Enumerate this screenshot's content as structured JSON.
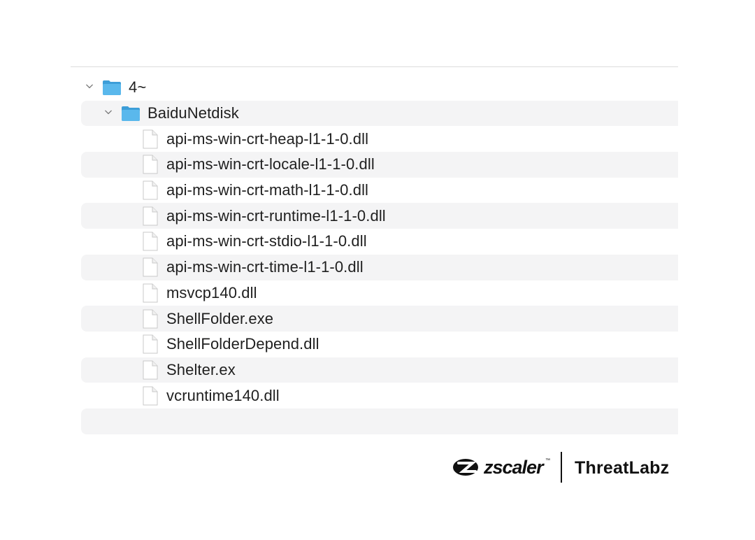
{
  "tree": {
    "rows": [
      {
        "kind": "folder",
        "depth": 0,
        "expanded": true,
        "name": "4~"
      },
      {
        "kind": "folder",
        "depth": 1,
        "expanded": true,
        "name": "BaiduNetdisk"
      },
      {
        "kind": "file",
        "depth": 2,
        "name": "api-ms-win-crt-heap-l1-1-0.dll"
      },
      {
        "kind": "file",
        "depth": 2,
        "name": "api-ms-win-crt-locale-l1-1-0.dll"
      },
      {
        "kind": "file",
        "depth": 2,
        "name": "api-ms-win-crt-math-l1-1-0.dll"
      },
      {
        "kind": "file",
        "depth": 2,
        "name": "api-ms-win-crt-runtime-l1-1-0.dll"
      },
      {
        "kind": "file",
        "depth": 2,
        "name": "api-ms-win-crt-stdio-l1-1-0.dll"
      },
      {
        "kind": "file",
        "depth": 2,
        "name": "api-ms-win-crt-time-l1-1-0.dll"
      },
      {
        "kind": "file",
        "depth": 2,
        "name": "msvcp140.dll"
      },
      {
        "kind": "file",
        "depth": 2,
        "name": "ShellFolder.exe"
      },
      {
        "kind": "file",
        "depth": 2,
        "name": "ShellFolderDepend.dll"
      },
      {
        "kind": "file",
        "depth": 2,
        "name": "Shelter.ex"
      },
      {
        "kind": "file",
        "depth": 2,
        "name": "vcruntime140.dll"
      }
    ]
  },
  "branding": {
    "company": "zscaler",
    "trademark": "™",
    "product": "ThreatLabz"
  },
  "icons": {
    "folder": "folder-icon",
    "file": "document-icon",
    "chevron": "chevron-down-icon",
    "logo": "zscaler-logo-icon"
  },
  "colors": {
    "folder_blue": "#5ab8ec",
    "stripe": "#f4f4f5",
    "text": "#1f1f1f"
  }
}
